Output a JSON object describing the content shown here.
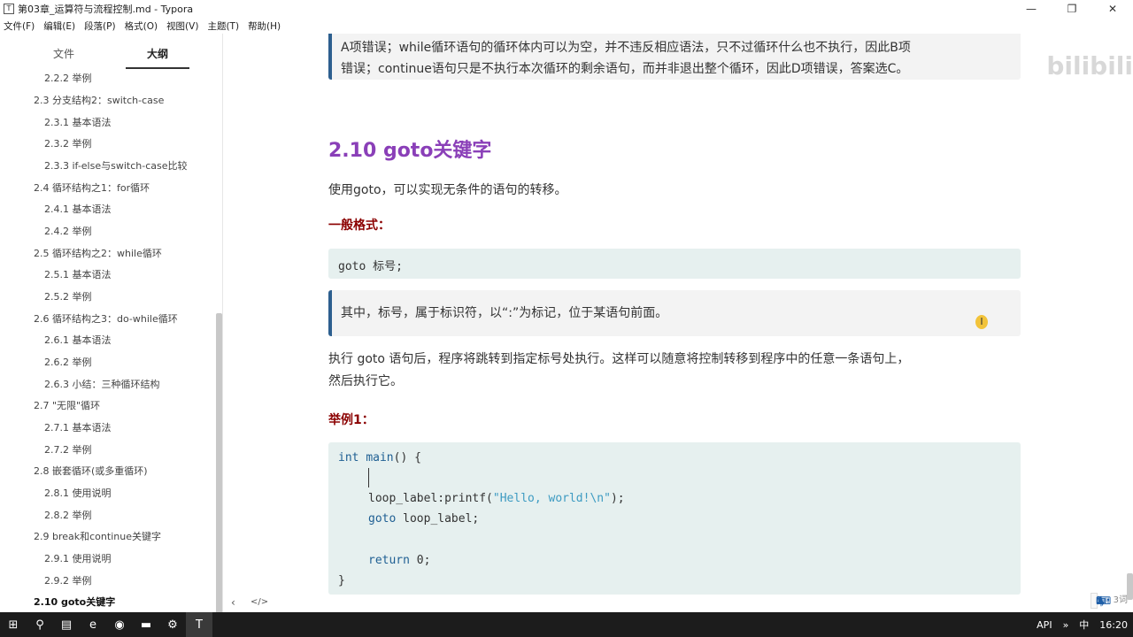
{
  "window": {
    "title": "第03章_运算符与流程控制.md - Typora",
    "app_icon": "T",
    "controls": [
      "—",
      "❐",
      "✕"
    ]
  },
  "menu": [
    "文件(F)",
    "编辑(E)",
    "段落(P)",
    "格式(O)",
    "视图(V)",
    "主题(T)",
    "帮助(H)"
  ],
  "sidebar": {
    "tabs": [
      "文件",
      "大纲"
    ],
    "active_tab": "大纲",
    "outline": [
      {
        "label": "2.2.2 举例",
        "level": 3
      },
      {
        "label": "2.3 分支结构2：switch-case",
        "level": 2
      },
      {
        "label": "2.3.1 基本语法",
        "level": 3
      },
      {
        "label": "2.3.2 举例",
        "level": 3
      },
      {
        "label": "2.3.3 if-else与switch-case比较",
        "level": 3
      },
      {
        "label": "2.4 循环结构之1：for循环",
        "level": 2
      },
      {
        "label": "2.4.1 基本语法",
        "level": 3
      },
      {
        "label": "2.4.2 举例",
        "level": 3
      },
      {
        "label": "2.5 循环结构之2：while循环",
        "level": 2
      },
      {
        "label": "2.5.1 基本语法",
        "level": 3
      },
      {
        "label": "2.5.2 举例",
        "level": 3
      },
      {
        "label": "2.6 循环结构之3：do-while循环",
        "level": 2
      },
      {
        "label": "2.6.1 基本语法",
        "level": 3
      },
      {
        "label": "2.6.2 举例",
        "level": 3
      },
      {
        "label": "2.6.3 小结：三种循环结构",
        "level": 3
      },
      {
        "label": "2.7 \"无限\"循环",
        "level": 2
      },
      {
        "label": "2.7.1 基本语法",
        "level": 3
      },
      {
        "label": "2.7.2 举例",
        "level": 3
      },
      {
        "label": "2.8 嵌套循环(或多重循环)",
        "level": 2
      },
      {
        "label": "2.8.1 使用说明",
        "level": 3
      },
      {
        "label": "2.8.2 举例",
        "level": 3
      },
      {
        "label": "2.9 break和continue关键字",
        "level": 2
      },
      {
        "label": "2.9.1 使用说明",
        "level": 3
      },
      {
        "label": "2.9.2 举例",
        "level": 3
      },
      {
        "label": "2.10 goto关键字",
        "level": 2,
        "active": true
      }
    ]
  },
  "content": {
    "prev_block_line1": "A项错误；while循环语句的循环体内可以为空，并不违反相应语法，只不过循环什么也不执行，因此B项",
    "prev_block_line2": "错误；continue语句只是不执行本次循环的剩余语句，而并非退出整个循环，因此D项错误，答案选C。",
    "heading": "2.10 goto关键字",
    "intro": "使用goto，可以实现无条件的语句的转移。",
    "format_label": "一般格式：",
    "format_code": "goto 标号;",
    "note": "其中，标号，属于标识符，以“:”为标记，位于某语句前面。",
    "desc_line1": "执行 goto 语句后，程序将跳转到指定标号处执行。这样可以随意将控制转移到程序中的任意一条语句上，",
    "desc_line2": "然后执行它。",
    "example_label": "举例1：",
    "code": {
      "l1_kw": "int",
      "l1_fn": "main",
      "l1_rest": "() {",
      "l3_a": "loop_label:printf(",
      "l3_str": "\"Hello, world!\\n\"",
      "l3_b": ");",
      "l4_kw": "goto",
      "l4_rest": " loop_label;",
      "l6_kw": "return",
      "l6_rest": " 0;",
      "l7": "}"
    },
    "cursor_glyph": "I"
  },
  "watermark": "bilibili",
  "statusbar": {
    "left_icon": "‹",
    "code_icon": "</>",
    "word_count": "3词"
  },
  "ime": [
    "中",
    "♪",
    "☾",
    "°,",
    "⌨",
    "♟",
    "✎"
  ],
  "taskbar": {
    "icons": [
      "⊞",
      "⚲",
      "▤",
      "e",
      "◉",
      "▬",
      "⚙",
      "T"
    ],
    "tray": [
      "API",
      "»",
      "中",
      "16:20"
    ]
  },
  "colors": {
    "heading": "#8a3fb8",
    "subheading": "#8b0000",
    "code_bg": "#e6f0ef",
    "quote_border": "#2d5f8f"
  }
}
